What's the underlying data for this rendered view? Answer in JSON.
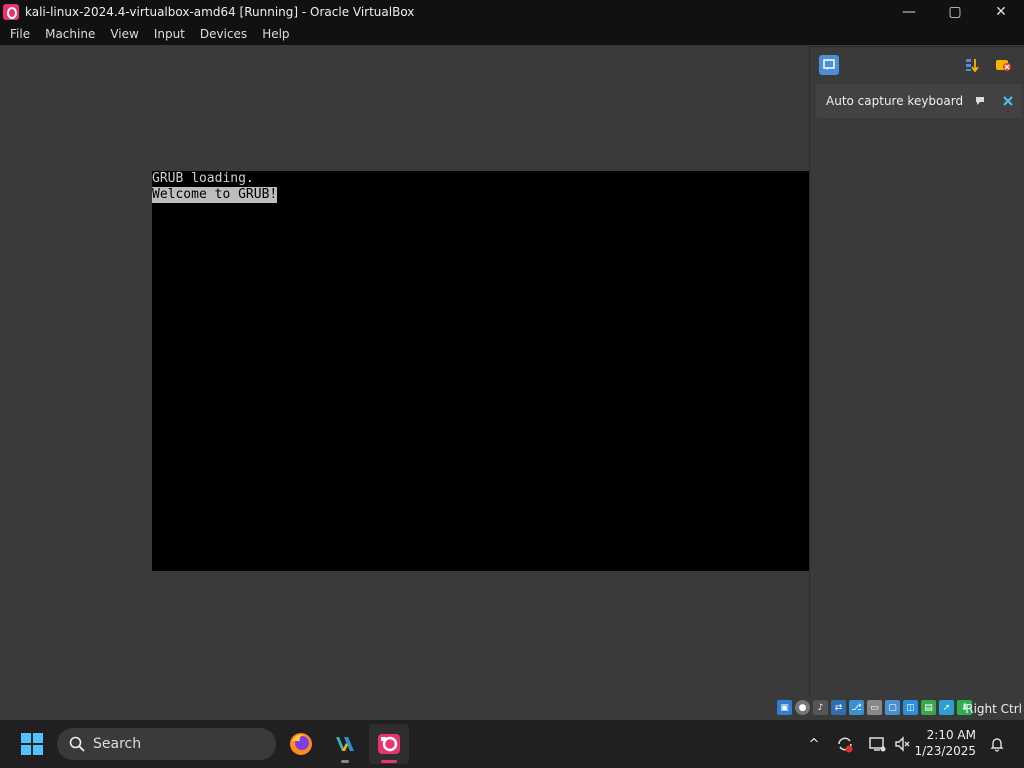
{
  "window": {
    "title": "kali-linux-2024.4-virtualbox-amd64 [Running] - Oracle VirtualBox",
    "controls": {
      "minimize": "—",
      "restore": "▢",
      "close": "✕"
    }
  },
  "menu": {
    "items": [
      "File",
      "Machine",
      "View",
      "Input",
      "Devices",
      "Help"
    ]
  },
  "vm": {
    "lines": [
      "GRUB loading.",
      "Welcome to GRUB!"
    ]
  },
  "notification_panel": {
    "card_text": "Auto capture keyboard ...",
    "icons": {
      "panel": "notification-center-icon",
      "sort": "sort-icon",
      "clear": "clear-all-icon",
      "pin": "pin-icon",
      "close": "close-icon"
    }
  },
  "statusbar": {
    "host_key": "Right Ctrl"
  },
  "taskbar": {
    "search_placeholder": "Search",
    "clock_time": "2:10 AM",
    "clock_date": "1/23/2025",
    "tray_chevron": "^"
  },
  "colors": {
    "accent": "#4cc2ff",
    "vbox_brand": "#e8356d",
    "taskbar_bg": "#202020"
  }
}
